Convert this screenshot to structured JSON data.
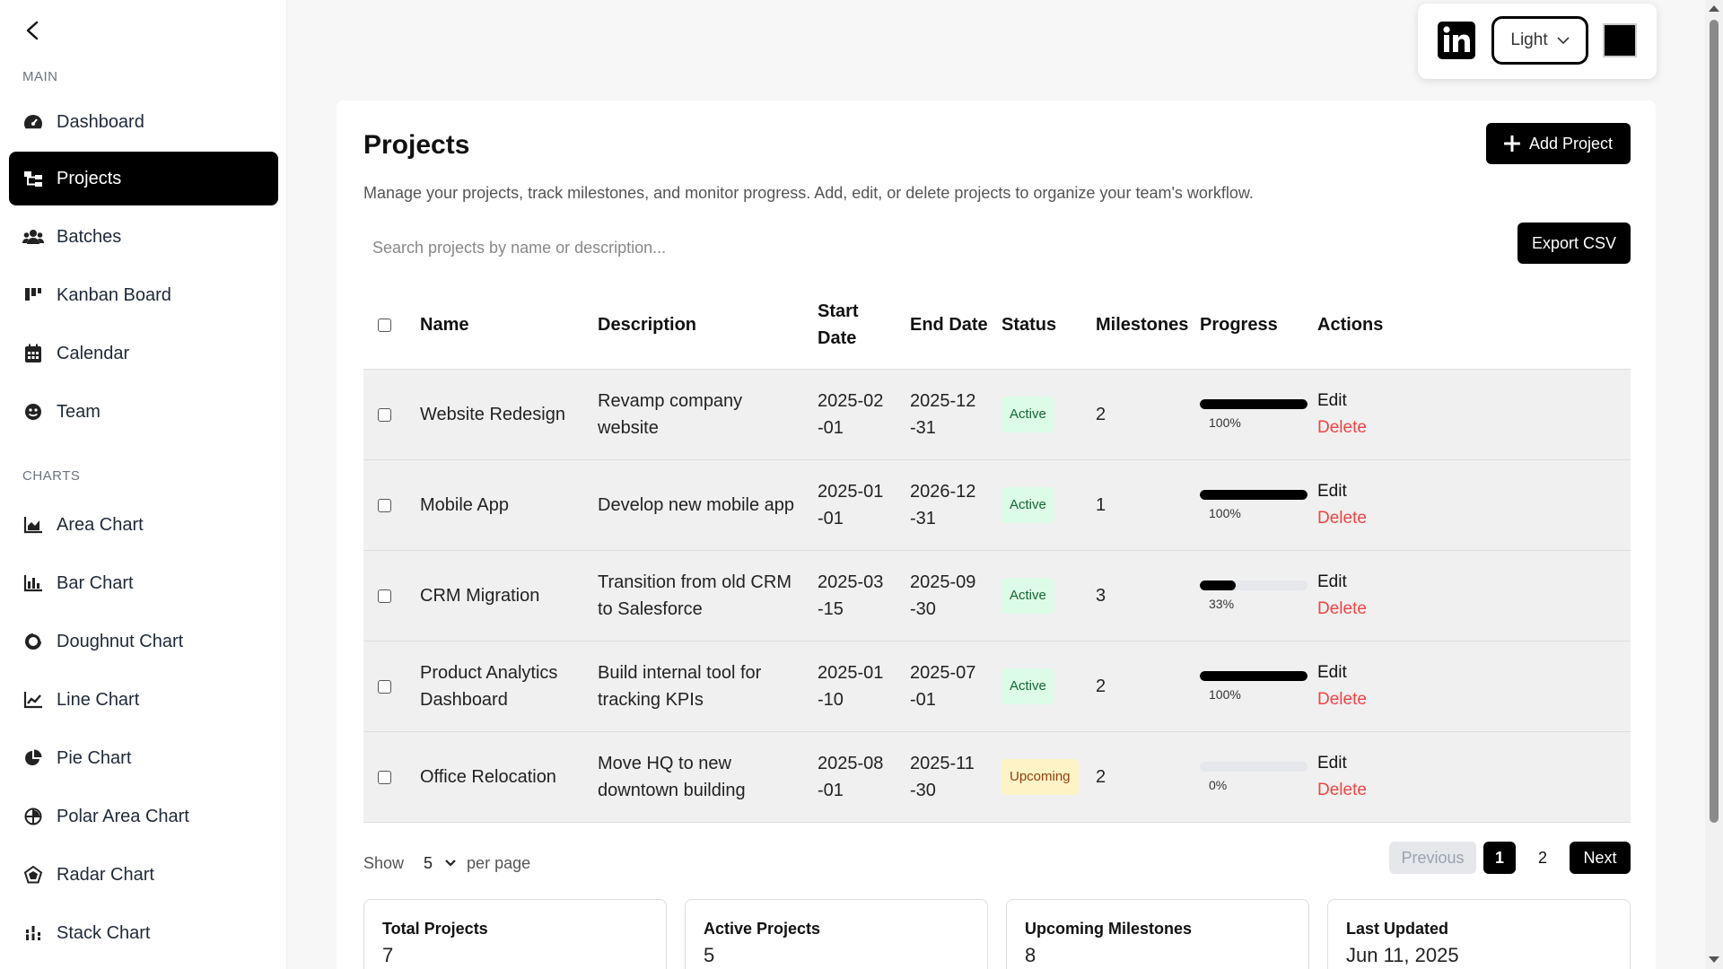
{
  "sidebar": {
    "sections": [
      {
        "label": "MAIN"
      },
      {
        "label": "CHARTS"
      }
    ],
    "items": [
      {
        "label": "Dashboard",
        "icon": "gauge-icon"
      },
      {
        "label": "Projects",
        "icon": "sitemap-icon",
        "active": true
      },
      {
        "label": "Batches",
        "icon": "users-icon"
      },
      {
        "label": "Kanban Board",
        "icon": "kanban-icon"
      },
      {
        "label": "Calendar",
        "icon": "calendar-icon"
      },
      {
        "label": "Team",
        "icon": "team-icon"
      },
      {
        "label": "Area Chart",
        "icon": "area-chart-icon"
      },
      {
        "label": "Bar Chart",
        "icon": "bar-chart-icon"
      },
      {
        "label": "Doughnut Chart",
        "icon": "doughnut-chart-icon"
      },
      {
        "label": "Line Chart",
        "icon": "line-chart-icon"
      },
      {
        "label": "Pie Chart",
        "icon": "pie-chart-icon"
      },
      {
        "label": "Polar Area Chart",
        "icon": "polar-area-chart-icon"
      },
      {
        "label": "Radar Chart",
        "icon": "radar-chart-icon"
      },
      {
        "label": "Stack Chart",
        "icon": "stack-chart-icon"
      }
    ]
  },
  "toolbar": {
    "theme": "Light",
    "accent_color": "#000000"
  },
  "page": {
    "title": "Projects",
    "add_label": "Add Project",
    "subtitle": "Manage your projects, track milestones, and monitor progress. Add, edit, or delete projects to organize your team's workflow.",
    "search_placeholder": "Search projects by name or description...",
    "export_label": "Export CSV"
  },
  "table": {
    "headers": {
      "name": "Name",
      "description": "Description",
      "start_date": "Start Date",
      "end_date": "End Date",
      "status": "Status",
      "milestones": "Milestones",
      "progress": "Progress",
      "actions": "Actions"
    },
    "edit_label": "Edit",
    "delete_label": "Delete",
    "rows": [
      {
        "name": "Website Redesign",
        "description": "Revamp company website",
        "start": "2025-02-01",
        "end": "2025-12-31",
        "status": "Active",
        "milestones": "2",
        "progress": 100,
        "progress_label": "100%"
      },
      {
        "name": "Mobile App",
        "description": "Develop new mobile app",
        "start": "2025-01-01",
        "end": "2026-12-31",
        "status": "Active",
        "milestones": "1",
        "progress": 100,
        "progress_label": "100%"
      },
      {
        "name": "CRM Migration",
        "description": "Transition from old CRM to Salesforce",
        "start": "2025-03-15",
        "end": "2025-09-30",
        "status": "Active",
        "milestones": "3",
        "progress": 33,
        "progress_label": "33%"
      },
      {
        "name": "Product Analytics Dashboard",
        "description": "Build internal tool for tracking KPIs",
        "start": "2025-01-10",
        "end": "2025-07-01",
        "status": "Active",
        "milestones": "2",
        "progress": 100,
        "progress_label": "100%"
      },
      {
        "name": "Office Relocation",
        "description": "Move HQ to new downtown building",
        "start": "2025-08-01",
        "end": "2025-11-30",
        "status": "Upcoming",
        "milestones": "2",
        "progress": 0,
        "progress_label": "0%"
      }
    ]
  },
  "pagination": {
    "show_label": "Show",
    "per_page_value": "5",
    "per_page_label": "per page",
    "previous_label": "Previous",
    "pages": [
      "1",
      "2"
    ],
    "current_page": "1",
    "next_label": "Next"
  },
  "stats": [
    {
      "label": "Total Projects",
      "value": "7"
    },
    {
      "label": "Active Projects",
      "value": "5"
    },
    {
      "label": "Upcoming Milestones",
      "value": "8"
    },
    {
      "label": "Last Updated",
      "value": "Jun 11, 2025"
    }
  ]
}
